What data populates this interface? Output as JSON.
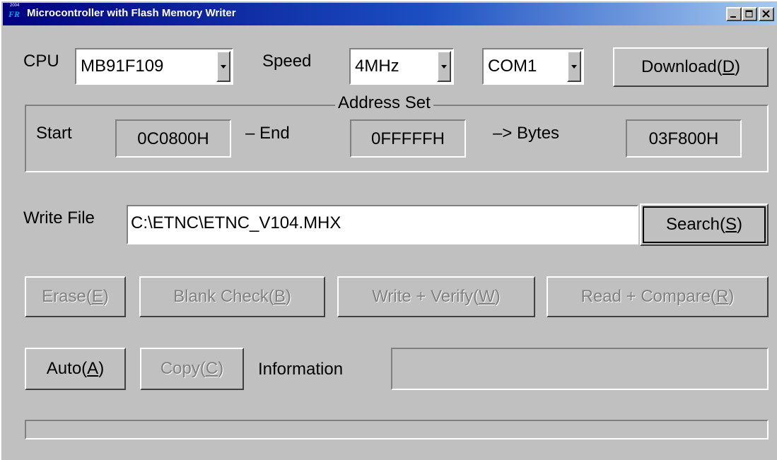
{
  "window": {
    "title": "Microcontroller with Flash Memory Writer",
    "app_icon_text": "FR",
    "app_icon_small": "2004"
  },
  "cpu": {
    "label": "CPU",
    "value": "MB91F109"
  },
  "speed": {
    "label": "Speed",
    "value": "4MHz"
  },
  "port": {
    "value": "COM1"
  },
  "download": {
    "label": "Download(",
    "accel": "D",
    "close": ")"
  },
  "address_set": {
    "title": "Address Set",
    "start_label": "Start",
    "start_value": "0C0800H",
    "end_label": "– End",
    "end_value": "0FFFFFH",
    "bytes_label": "–> Bytes",
    "bytes_value": "03F800H"
  },
  "write_file": {
    "label": "Write File",
    "value": "C:\\ETNC\\ETNC_V104.MHX"
  },
  "search": {
    "label": "Search(",
    "accel": "S",
    "close": ")"
  },
  "actions": {
    "erase": {
      "label": "Erase(",
      "accel": "E",
      "close": ")"
    },
    "blank_check": {
      "label": "Blank Check(",
      "accel": "B",
      "close": ")"
    },
    "write_verify": {
      "label": "Write + Verify(",
      "accel": "W",
      "close": ")"
    },
    "read_compare": {
      "label": "Read + Compare(",
      "accel": "R",
      "close": ")"
    },
    "auto": {
      "label": "Auto(",
      "accel": "A",
      "close": ")"
    },
    "copy": {
      "label": "Copy(",
      "accel": "C",
      "close": ")"
    }
  },
  "information": {
    "label": "Information",
    "value": ""
  },
  "progress": {
    "value": 0
  },
  "colors": {
    "titlebar_start": "#000080",
    "titlebar_end": "#a6caf0",
    "face": "#c0c0c0"
  }
}
